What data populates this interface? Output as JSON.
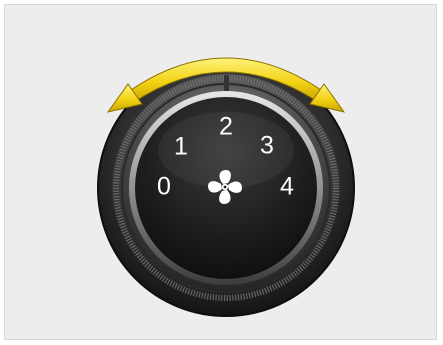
{
  "knob": {
    "control": "fan-speed",
    "icon": "fan-icon",
    "positions": [
      {
        "label": "0"
      },
      {
        "label": "1"
      },
      {
        "label": "2"
      },
      {
        "label": "3"
      },
      {
        "label": "4"
      }
    ],
    "rotation_hint": "rotate-both-directions"
  },
  "colors": {
    "background": "#ededed",
    "arrow": "#f3d214",
    "knob_face": "#1a1a1a",
    "numbers": "#ffffff"
  }
}
